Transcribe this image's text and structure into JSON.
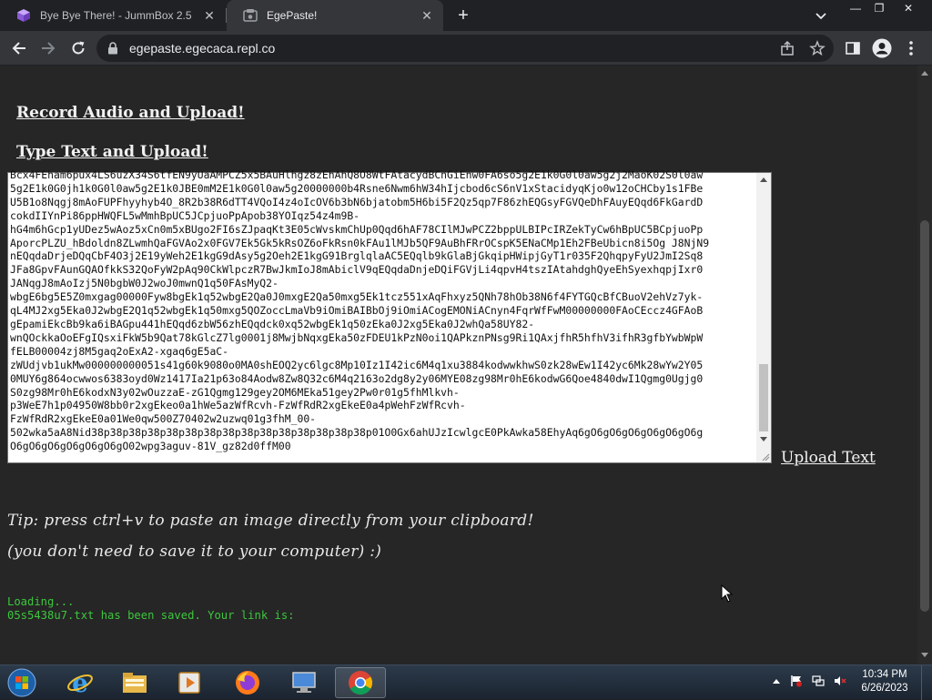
{
  "browser": {
    "tabs": [
      {
        "title": "Bye Bye There! - JummBox 2.5",
        "active": false,
        "icon": "jummbox-cube-icon"
      },
      {
        "title": "EgePaste!",
        "active": true,
        "icon": "egepaste-favicon-icon"
      }
    ],
    "url": "egepaste.egecaca.repl.co"
  },
  "page": {
    "record_link": "Record Audio and Upload!",
    "type_link": "Type Text and Upload!",
    "textarea_lines": [
      "Bcx4FEham6pux4LS6uzX34S6tfEN9yUaAMPCZ5x5BAuHlhgz8zEhAhQ8O8WtFAtacydBCnGiEnw0FA6so5g2E1k0G0l0aw5g2j2MaoK02S0l0aw",
      "5g2E1k0G0jh1k0G0l0aw5g2E1k0JBE0mM2E1k0G0l0aw5g20000000b4Rsne6Nwm6hW34hIjcbod6cS6nV1xStacidyqKjo0w12oCHCby1s1FBe",
      "U5B1o8Nqgj8mAoFUPFhyyhyb4O_8R2b38R6dTT4VQoI4z4oIcOV6b3bN6bjatobm5H6bi5F2Qz5qp7F86zhEQGsyFGVQeDhFAuyEQqd6FkGardD",
      "cokdIIYnPi86ppHWQFL5wMmhBpUC5JCpjuoPpApob38YOIqz54z4m9B-",
      "hG4m6hGcp1yUDez5wAoz5xCn0m5xBUgo2FI6sZJpaqKt3E05cWvskmChUp0Qqd6hAF78CIlMJwPCZ2bppULBIPcIRZekTyCw6hBpUC5BCpjuoPp",
      "AporcPLZU_hBdoldn8ZLwmhQaFGVAo2x0FGV7Ek5Gk5kRsOZ6oFkRsn0kFAu1lMJb5QF9AuBhFRrOCspK5ENaCMp1Eh2FBeUbicn8i5Og J8NjN9",
      "nEQqdaDrjeDQqCbF4O3j2E19yWeh2E1kgG9dAsy5g2Oeh2E1kgG91BrglqlaAC5EQqlb9kGlaBjGkqipHWipjGyT1r035F2QhqpyFyU2JmI2Sq8",
      "JFa8GpvFAunGQAOfkkS32QoFyW2pAq90CkWlpczR7BwJkmIoJ8mAbiclV9qEQqdaDnjeDQiFGVjLi4qpvH4tszIAtahdghQyeEhSyexhqpjIxr0",
      "JANqgJ8mAoIzj5N0bgbW0J2woJ0mwnQ1q50FAsMyQ2-",
      "wbgE6bg5E5Z0mxgag00000Fyw8bgEk1q52wbgE2Qa0J0mxgE2Qa50mxg5Ek1tcz551xAqFhxyz5QNh78hOb38N6f4FYTGQcBfCBuoV2ehVz7yk-",
      "qL4MJ2xg5Eka0J2wbgE2Q1q52wbgEk1q50mxg5QOZoccLmaVb9iOmiBAIBbOj9iOmiACogEMONiACnyn4FqrWfFwM00000000FAoCEccz4GFAoB",
      "gEpamiEkcBb9ka6iBAGpu441hEQqd6zbW56zhEQqdck0xq52wbgEk1q50zEka0J2xg5Eka0J2whQa58UY82-",
      "wnQOckkaOoEFgIQsxiFkW5b9Qat78kGlcZ7lg0001j8MwjbNqxgEka50zFDEU1kPzN0oi1QAPkznPNsg9Ri1QAxjfhR5hfhV3ifhR3gfbYwbWpW",
      "fELB00004zj8M5gaq2oExA2-xgaq6gE5aC-",
      "zWUdjvb1ukMw000000000051s41g60k9080o0MA0shEOQ2yc6lgc8Mp10Iz1I42ic6M4q1xu3884kodwwkhwS0zk28wEw1I42yc6Mk28wYw2Y05",
      "0MUY6g864ocwwos6383oyd0Wz1417Ia21p63o84Aodw8Zw8Q32c6M4q2163o2dg8y2y06MYE08zg98Mr0hE6kodwG6Qoe4840dwI1Qgmg0Ugjg0",
      "S0zg98Mr0hE6kodxN3y02wOuzzaE-zG1Qgmg129gey2OM6MEka51gey2Pw0r01g5fhMlkvh-",
      "p3WeE7h1p04950W8bb0r2xgEkeo0a1hWe5azWfRcvh-FzWfRdR2xgEkeE0a4pWehFzWfRcvh-",
      "FzWfRdR2xgEkeE0a01We0qw500Z70402w2uzwq01g3fhM_00-",
      "502wka5aA8Nid38p38p38p38p38p38p38p38p38p38p38p38p38p38p38p01O0Gx6ahUJzIcwlgcE0PkAwka58EhyAq6gO6gO6gO6gO6gO6gO6g",
      "O6gO6gO6gO6gO6gO6gO02wpg3aguv-81V_gz82d0ffM00"
    ],
    "upload_button": "Upload Text",
    "tip_line1": "Tip: press ctrl+v to paste an image directly from your clipboard!",
    "tip_line2": "(you don't need to save it to your computer) :)",
    "console_loading": "Loading...",
    "console_saved_prefix": "05s5438u7.txt has been saved. Your link is: ",
    "console_saved_link": ""
  },
  "taskbar": {
    "apps": [
      "internet-explorer-icon",
      "file-explorer-icon",
      "media-player-icon",
      "firefox-icon",
      "remote-desktop-icon",
      "chrome-icon"
    ],
    "active_app": "chrome-icon",
    "time": "10:34 PM",
    "date": "6/26/2023"
  },
  "colors": {
    "page_bg": "#262626",
    "console_green": "#3ec63e",
    "link_blue": "#4a6fe0"
  }
}
